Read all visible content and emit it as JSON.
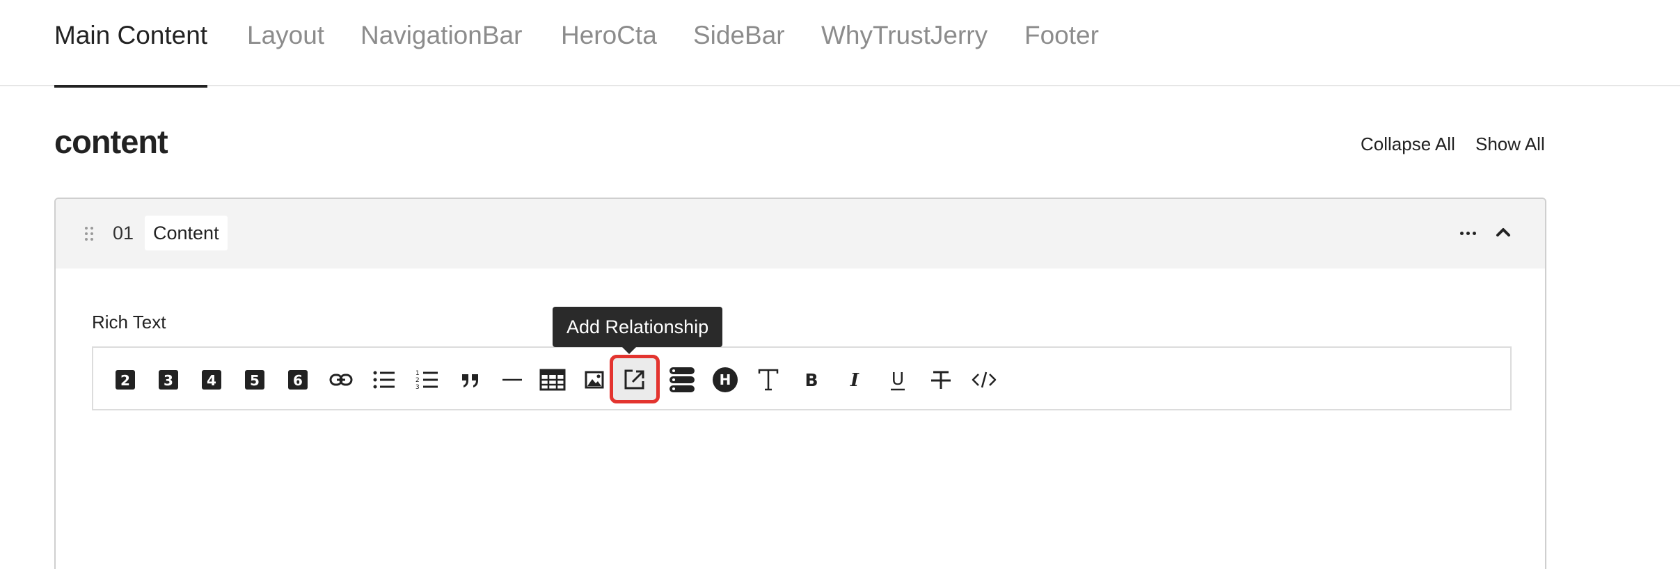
{
  "tabs": [
    {
      "label": "Main Content",
      "active": true
    },
    {
      "label": "Layout",
      "active": false
    },
    {
      "label": "NavigationBar",
      "active": false
    },
    {
      "label": "HeroCta",
      "active": false
    },
    {
      "label": "SideBar",
      "active": false
    },
    {
      "label": "WhyTrustJerry",
      "active": false
    },
    {
      "label": "Footer",
      "active": false
    }
  ],
  "section": {
    "heading": "content",
    "collapse_all": "Collapse All",
    "show_all": "Show All"
  },
  "block": {
    "number": "01",
    "title": "Content",
    "field_label": "Rich Text"
  },
  "toolbar": {
    "tooltip": "Add Relationship",
    "items": [
      {
        "icon": "heading-2-icon",
        "glyph": "2"
      },
      {
        "icon": "heading-3-icon",
        "glyph": "3"
      },
      {
        "icon": "heading-4-icon",
        "glyph": "4"
      },
      {
        "icon": "heading-5-icon",
        "glyph": "5"
      },
      {
        "icon": "heading-6-icon",
        "glyph": "6"
      },
      {
        "icon": "link-icon"
      },
      {
        "icon": "bulleted-list-icon"
      },
      {
        "icon": "numbered-list-icon"
      },
      {
        "icon": "blockquote-icon"
      },
      {
        "icon": "horizontal-rule-icon"
      },
      {
        "icon": "table-icon"
      },
      {
        "icon": "image-icon"
      },
      {
        "icon": "add-relationship-icon",
        "highlighted": true
      },
      {
        "icon": "blocks-icon"
      },
      {
        "icon": "heading-circle-icon",
        "glyph": "H"
      },
      {
        "icon": "text-icon"
      },
      {
        "icon": "bold-icon",
        "glyph": "B"
      },
      {
        "icon": "italic-icon",
        "glyph": "I"
      },
      {
        "icon": "underline-icon",
        "glyph": "U"
      },
      {
        "icon": "strikethrough-icon"
      },
      {
        "icon": "code-icon"
      }
    ]
  },
  "colors": {
    "accent_highlight": "#e3342f",
    "tooltip_bg": "#2a2a2a",
    "header_bg": "#f3f3f3"
  }
}
